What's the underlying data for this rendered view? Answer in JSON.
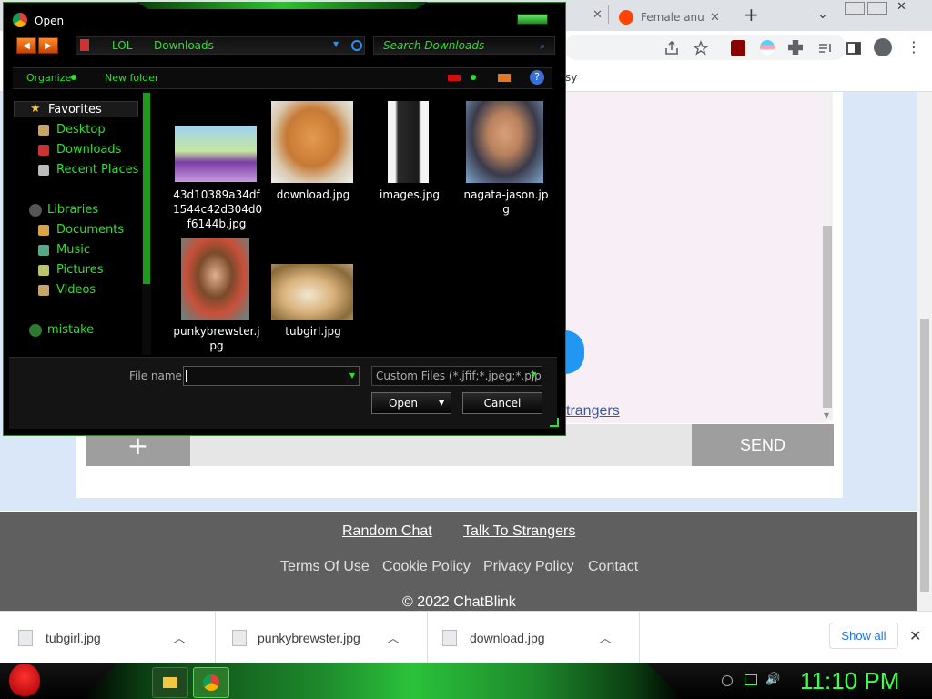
{
  "browser": {
    "tabs": [
      {
        "title": "Female anus",
        "favicon": "reddit-icon"
      }
    ],
    "bookmark_partial": "sy"
  },
  "chat": {
    "strangers_link": "trangers",
    "plus_label": "+",
    "send_label": "SEND"
  },
  "footer": {
    "links_top": [
      "Random Chat",
      "Talk To Strangers"
    ],
    "links_bottom": [
      "Terms Of Use",
      "Cookie Policy",
      "Privacy Policy",
      "Contact"
    ],
    "copyright": "© 2022 ChatBlink"
  },
  "downloads": {
    "items": [
      "tubgirl.jpg",
      "punkybrewster.jpg",
      "download.jpg"
    ],
    "show_all": "Show all"
  },
  "taskbar": {
    "clock": "11:10 PM"
  },
  "dialog": {
    "title": "Open",
    "address": {
      "part1": "LOL",
      "part2": "Downloads"
    },
    "search_placeholder": "Search Downloads",
    "organize": "Organize",
    "new_folder": "New folder",
    "nav": {
      "favorites": "Favorites",
      "desktop": "Desktop",
      "downloads": "Downloads",
      "recent": "Recent Places",
      "libraries": "Libraries",
      "documents": "Documents",
      "music": "Music",
      "pictures": "Pictures",
      "videos": "Videos",
      "mistake": "mistake"
    },
    "files": [
      {
        "line1": "43d10389a34df",
        "line2": "1544c42d304d0",
        "line3": "f6144b.jpg"
      },
      {
        "line1": "download.jpg"
      },
      {
        "line1": "images.jpg"
      },
      {
        "line1": "nagata-jason.jp",
        "line2": "g"
      },
      {
        "line1": "punkybrewster.j",
        "line2": "pg"
      },
      {
        "line1": "tubgirl.jpg"
      }
    ],
    "filename_label": "File name:",
    "filename_value": "",
    "filter": "Custom Files (*.jfif;*.jpeg;*.pjp;*",
    "open_label": "Open",
    "cancel_label": "Cancel"
  },
  "colors": {
    "accent_green": "#2fe02f",
    "footer_bg": "#5f5f5f",
    "page_bg": "#dae7f8",
    "link_blue": "#1a73e8"
  }
}
